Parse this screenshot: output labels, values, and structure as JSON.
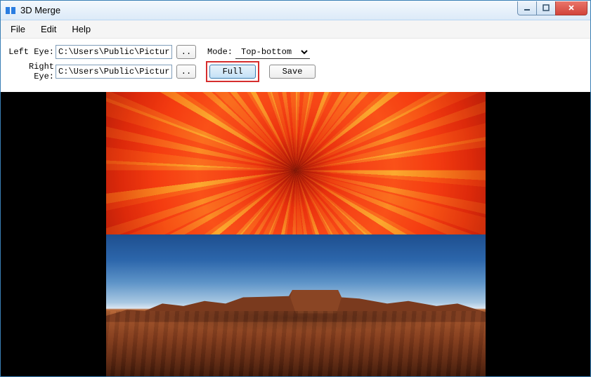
{
  "window": {
    "title": "3D Merge"
  },
  "menu": {
    "file": "File",
    "edit": "Edit",
    "help": "Help"
  },
  "form": {
    "left_label": "Left Eye:",
    "right_label": "Right Eye:",
    "left_path": "C:\\Users\\Public\\Pictures\\Sa",
    "right_path": "C:\\Users\\Public\\Pictures\\Sa",
    "browse_label": "..",
    "mode_label": "Mode:",
    "mode_value": "Top-bottom",
    "full_label": "Full",
    "save_label": "Save"
  }
}
